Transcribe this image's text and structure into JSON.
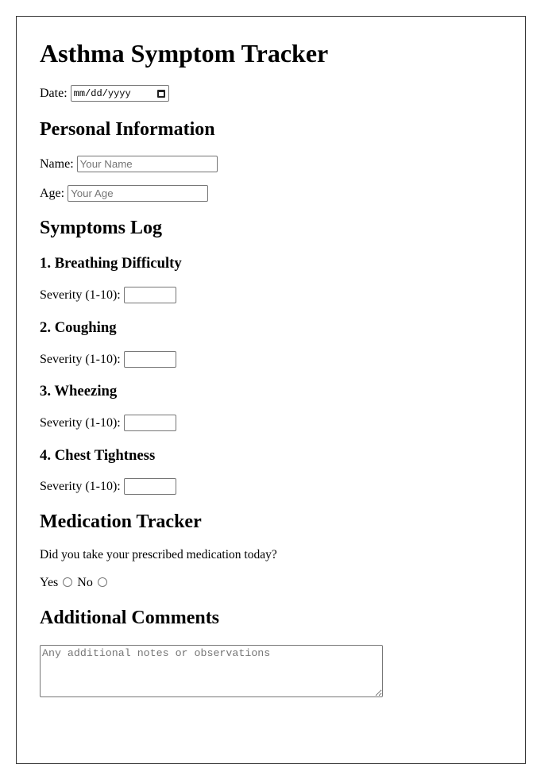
{
  "page": {
    "title": "Asthma Symptom Tracker"
  },
  "date": {
    "label": "Date:",
    "placeholder": "mm/dd/yyyy",
    "icon": "calendar-icon"
  },
  "personal_info": {
    "heading": "Personal Information",
    "name": {
      "label": "Name:",
      "value": "",
      "placeholder": "Your Name"
    },
    "age": {
      "label": "Age:",
      "value": "",
      "placeholder": "Your Age"
    }
  },
  "symptoms_log": {
    "heading": "Symptoms Log",
    "items": [
      {
        "title": "1. Breathing Difficulty",
        "severity_label": "Severity (1-10):",
        "value": ""
      },
      {
        "title": "2. Coughing",
        "severity_label": "Severity (1-10):",
        "value": ""
      },
      {
        "title": "3. Wheezing",
        "severity_label": "Severity (1-10):",
        "value": ""
      },
      {
        "title": "4. Chest Tightness",
        "severity_label": "Severity (1-10):",
        "value": ""
      }
    ]
  },
  "medication": {
    "heading": "Medication Tracker",
    "question": "Did you take your prescribed medication today?",
    "options": [
      {
        "label": "Yes",
        "selected": false
      },
      {
        "label": "No",
        "selected": false
      }
    ]
  },
  "comments": {
    "heading": "Additional Comments",
    "value": "",
    "placeholder": "Any additional notes or observations"
  }
}
